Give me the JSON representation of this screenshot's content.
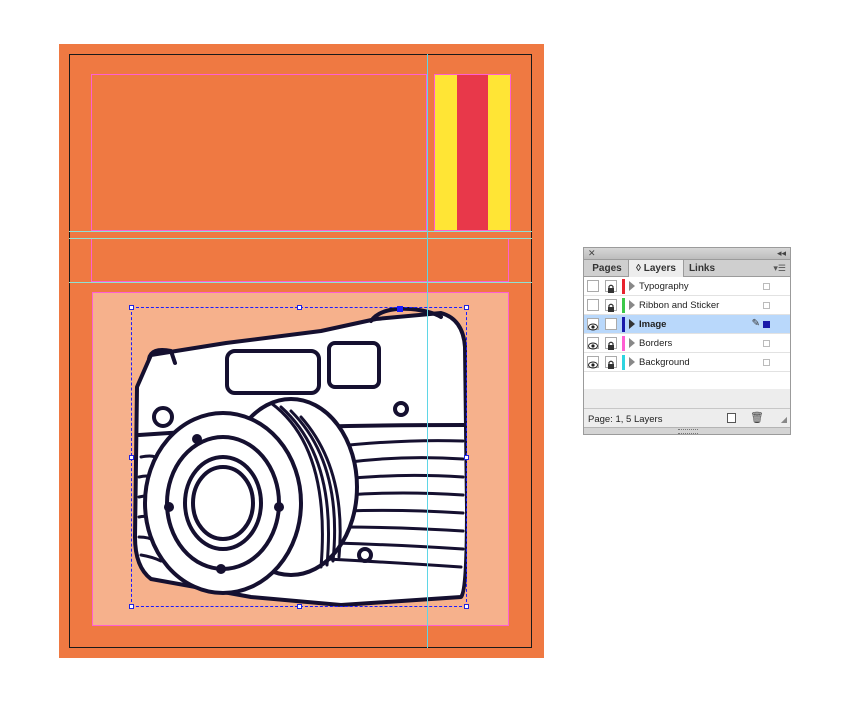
{
  "colors": {
    "page": "#ef7942",
    "image_frame": "#f6b18c",
    "ribbon_yellow": "#ffe535",
    "ribbon_red": "#e8384a",
    "frame_edge": "#ff5fd2",
    "guide_color": "#8fe3d2",
    "selection": "#1a1aff"
  },
  "panel": {
    "tabs": [
      {
        "label": "Pages"
      },
      {
        "label": "◊ Layers"
      },
      {
        "label": "Links"
      }
    ],
    "layers": [
      {
        "name": "Typography",
        "color": "#e8232e",
        "visible": false,
        "locked": true,
        "selected": false
      },
      {
        "name": "Ribbon and Sticker",
        "color": "#3cc84a",
        "visible": false,
        "locked": true,
        "selected": false
      },
      {
        "name": "Image",
        "color": "#1a1aaa",
        "visible": true,
        "locked": false,
        "selected": true
      },
      {
        "name": "Borders",
        "color": "#ff5fd2",
        "visible": true,
        "locked": true,
        "selected": false
      },
      {
        "name": "Background",
        "color": "#2ed4e0",
        "visible": true,
        "locked": true,
        "selected": false
      }
    ],
    "status": "Page: 1, 5 Layers",
    "icons": {
      "close": "close-icon",
      "collapse": "double-arrow-icon",
      "menu": "panel-menu-icon",
      "new_layer": "new-layer-icon",
      "delete": "trash-icon",
      "pen": "pen-icon"
    }
  }
}
